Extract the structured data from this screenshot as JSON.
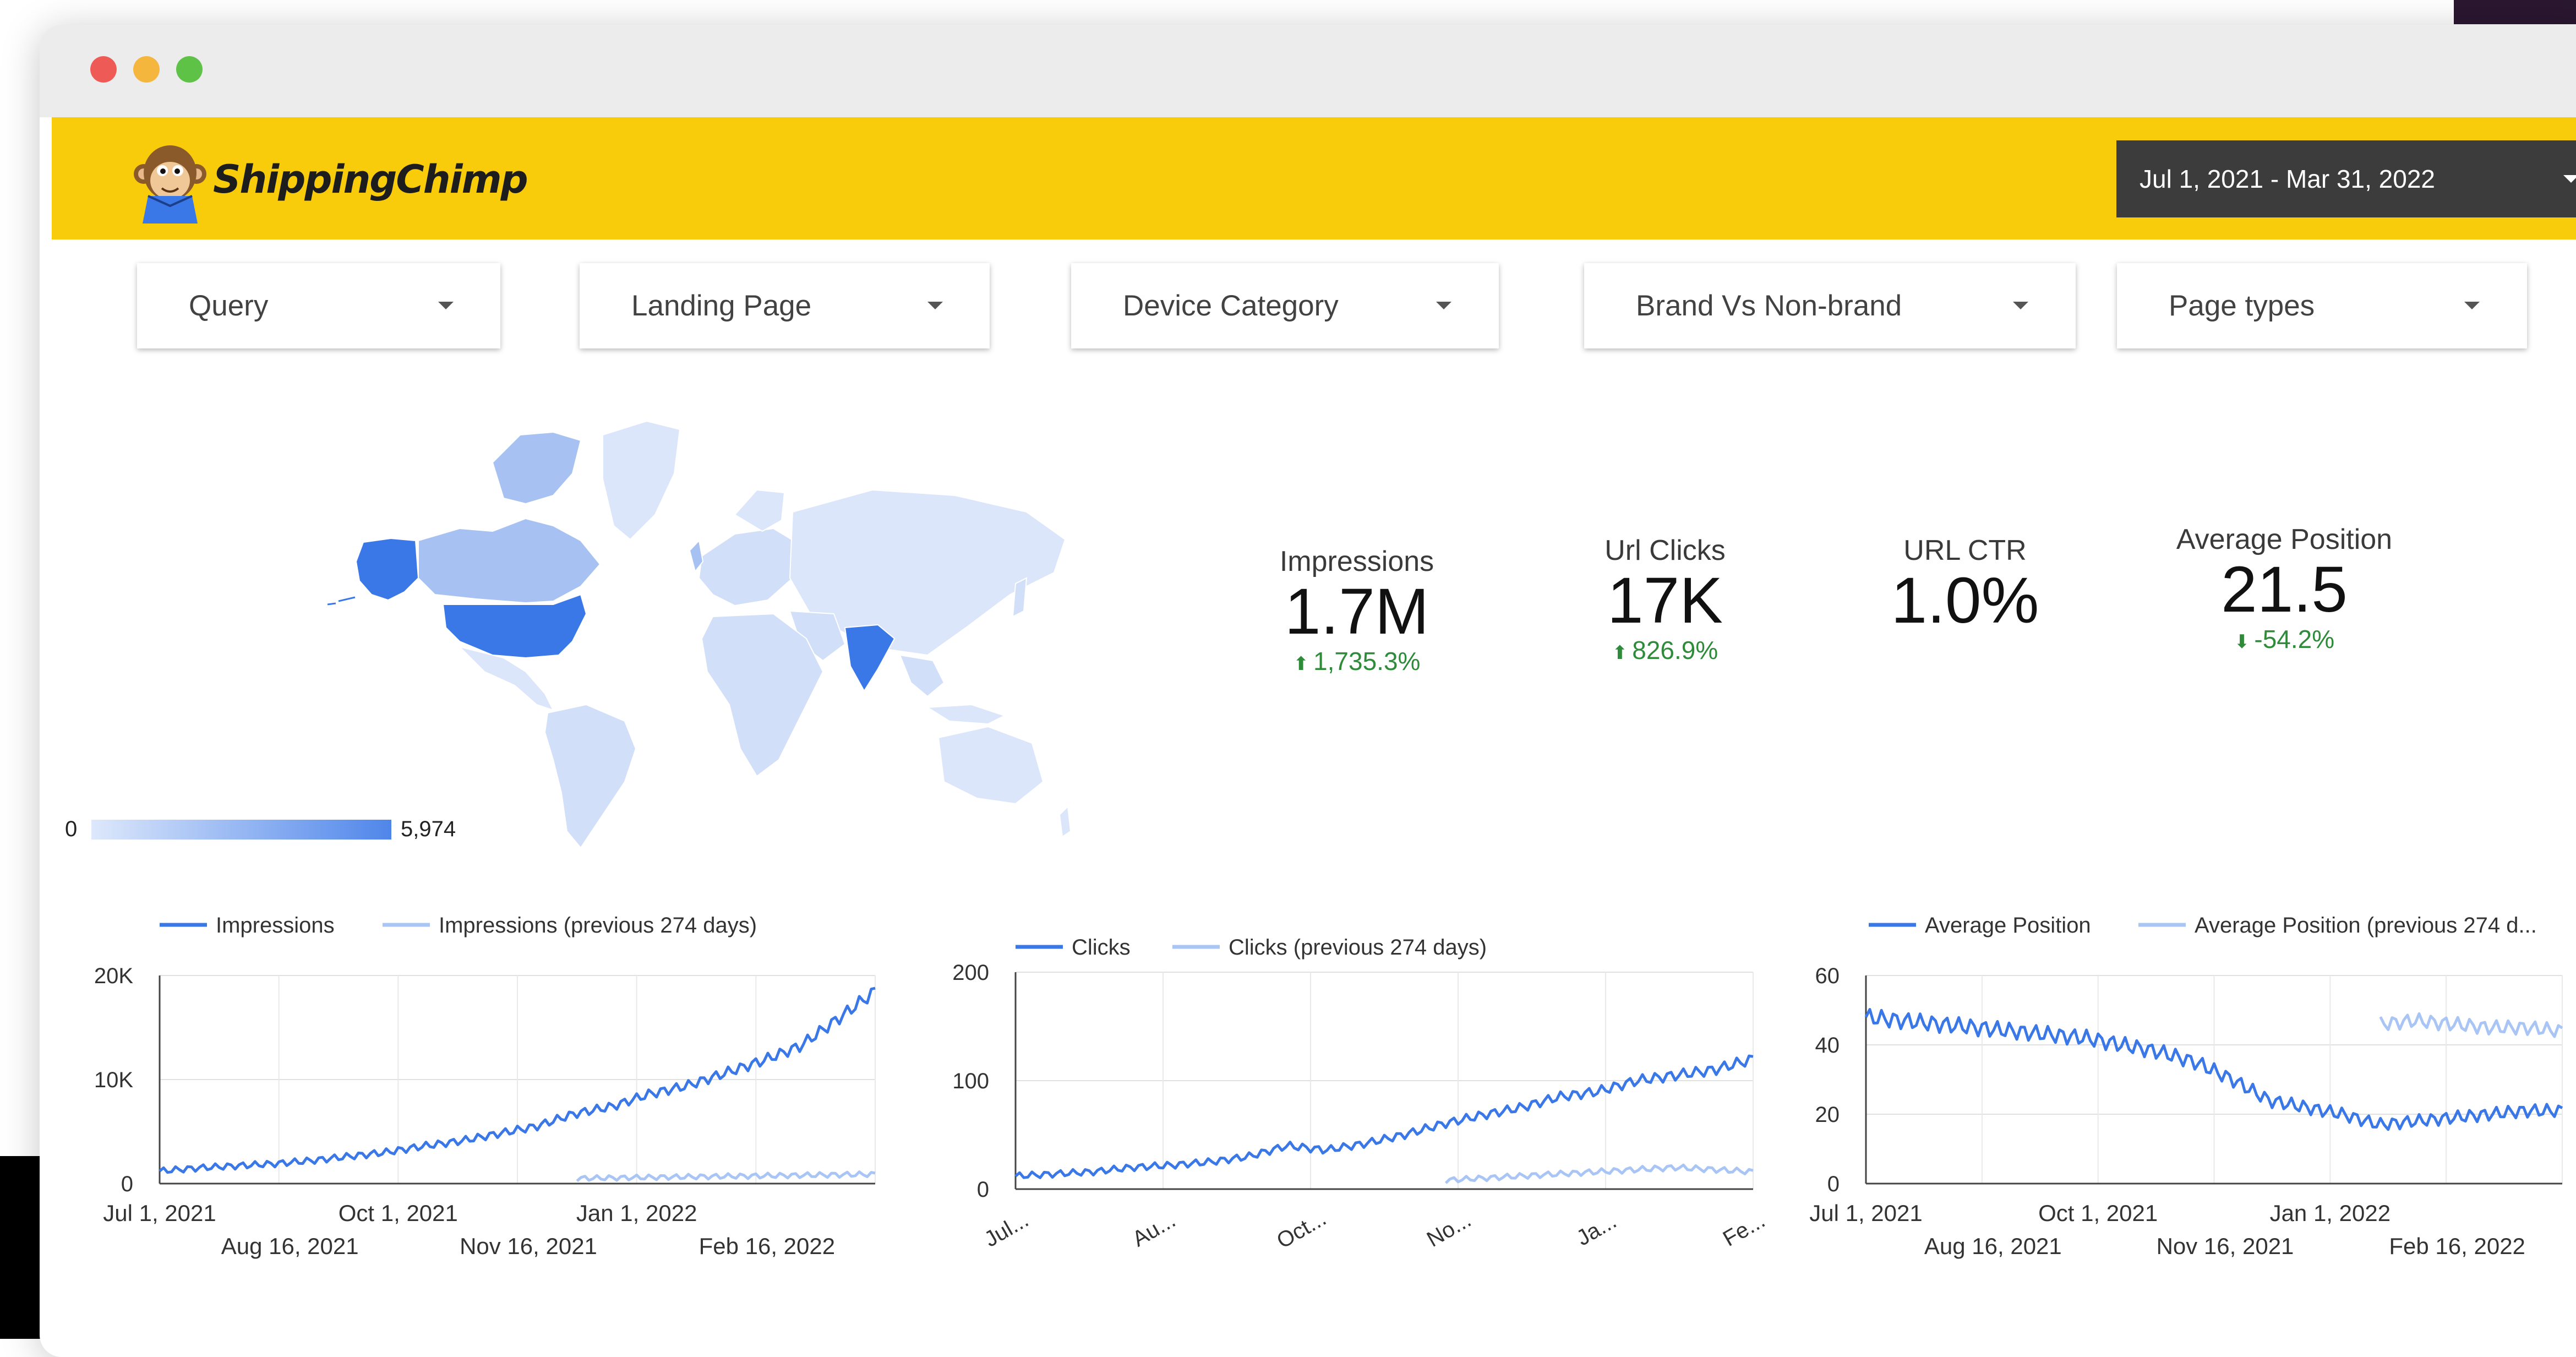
{
  "brand": {
    "name": "ShippingChimp"
  },
  "header": {
    "date_range": "Jul 1, 2021 - Mar 31, 2022"
  },
  "filters": [
    {
      "label": "Query"
    },
    {
      "label": "Landing Page"
    },
    {
      "label": "Device Category"
    },
    {
      "label": "Brand Vs Non-brand"
    },
    {
      "label": "Page types"
    }
  ],
  "map": {
    "legend_min": "0",
    "legend_max": "5,974",
    "scale_low_color": "#dde8fb",
    "scale_high_color": "#4f86ea"
  },
  "kpis": [
    {
      "label": "Impressions",
      "value": "1.7M",
      "delta": "1,735.3%",
      "direction": "up"
    },
    {
      "label": "Url Clicks",
      "value": "17K",
      "delta": "826.9%",
      "direction": "up"
    },
    {
      "label": "URL CTR",
      "value": "1.0%",
      "delta": "",
      "direction": ""
    },
    {
      "label": "Average Position",
      "value": "21.5",
      "delta": "-54.2%",
      "direction": "down"
    }
  ],
  "colors": {
    "current": "#3b78e7",
    "previous": "#a9c5f5",
    "positive": "#2e8b3a",
    "header": "#f9cc0b"
  },
  "chart_data": [
    {
      "type": "line",
      "series": [
        {
          "name": "Impressions",
          "values": [
            1200,
            1500,
            1700,
            1900,
            2200,
            2600,
            3000,
            3600,
            4100,
            4800,
            5500,
            6700,
            7400,
            8600,
            9400,
            10600,
            11800,
            13200,
            15800,
            18500
          ]
        },
        {
          "name": "Impressions (previous 274 days)",
          "values": [
            0,
            0,
            0,
            0,
            0,
            0,
            0,
            0,
            0,
            0,
            0,
            500,
            550,
            600,
            650,
            700,
            750,
            800,
            850,
            900
          ]
        }
      ],
      "x_ticks_row1": [
        "Jul 1, 2021",
        "Oct 1, 2021",
        "Jan 1, 2022"
      ],
      "x_ticks_row2": [
        "Aug 16, 2021",
        "Nov 16, 2021",
        "Feb 16, 2022"
      ],
      "y_ticks": [
        "0",
        "10K",
        "20K"
      ],
      "ylim": [
        0,
        20000
      ],
      "legend_position": "top",
      "grid": true
    },
    {
      "type": "line",
      "series": [
        {
          "name": "Clicks",
          "values": [
            12,
            14,
            16,
            20,
            22,
            25,
            30,
            40,
            36,
            42,
            50,
            60,
            68,
            75,
            85,
            90,
            100,
            105,
            110,
            120
          ]
        },
        {
          "name": "Clicks (previous 274 days)",
          "values": [
            0,
            0,
            0,
            0,
            0,
            0,
            0,
            0,
            0,
            0,
            0,
            8,
            10,
            12,
            14,
            16,
            18,
            20,
            18,
            16
          ]
        }
      ],
      "x_ticks": [
        "Jul...",
        "Au...",
        "Oct...",
        "No...",
        "Ja...",
        "Fe..."
      ],
      "y_ticks": [
        "0",
        "100",
        "200"
      ],
      "ylim": [
        0,
        200
      ],
      "legend_position": "top",
      "grid": true
    },
    {
      "type": "line",
      "series": [
        {
          "name": "Average Position",
          "values": [
            48,
            47,
            46,
            45,
            44,
            43,
            42,
            40,
            38,
            35,
            30,
            24,
            22,
            20,
            17,
            18,
            19,
            20,
            21,
            21
          ]
        },
        {
          "name": "Average Position (previous 274 d...",
          "values": [
            null,
            null,
            null,
            null,
            null,
            null,
            null,
            null,
            null,
            null,
            null,
            null,
            null,
            null,
            46,
            47,
            46,
            45,
            45,
            44
          ]
        }
      ],
      "x_ticks_row1": [
        "Jul 1, 2021",
        "Oct 1, 2021",
        "Jan 1, 2022"
      ],
      "x_ticks_row2": [
        "Aug 16, 2021",
        "Nov 16, 2021",
        "Feb 16, 2022"
      ],
      "y_ticks": [
        "0",
        "20",
        "40",
        "60"
      ],
      "ylim": [
        0,
        60
      ],
      "legend_position": "top",
      "grid": true
    }
  ]
}
